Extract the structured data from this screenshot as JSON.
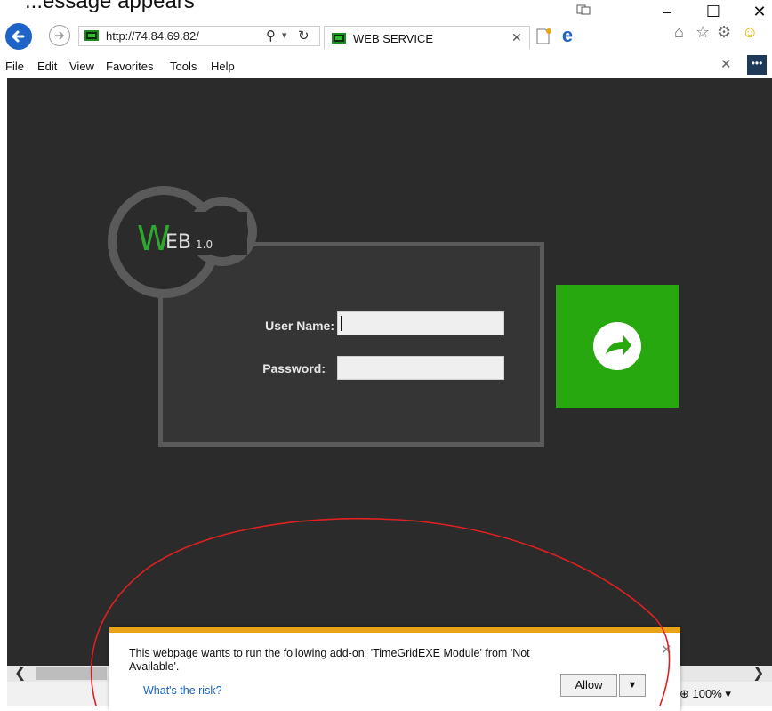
{
  "caption": "...essage appears",
  "browser": {
    "address_url": "http://74.84.69.82/",
    "tab_title": "WEB SERVICE",
    "menu": [
      "File",
      "Edit",
      "View",
      "Favorites",
      "Tools",
      "Help"
    ],
    "zoom": "100%"
  },
  "login": {
    "logo_letter": "W",
    "logo_rest": "EB",
    "logo_version": "1.0",
    "username_label": "User Name:",
    "password_label": "Password:",
    "username_value": "",
    "password_value": ""
  },
  "notification": {
    "message": "This webpage wants to run the following add-on: 'TimeGridEXE Module' from 'Not Available'.",
    "risk_link": "What's the risk?",
    "allow_label": "Allow"
  },
  "colors": {
    "accent_green": "#26a80e",
    "notify_bar": "#e8a317",
    "annotation_red": "#e02020",
    "page_bg": "#2b2b2b"
  }
}
